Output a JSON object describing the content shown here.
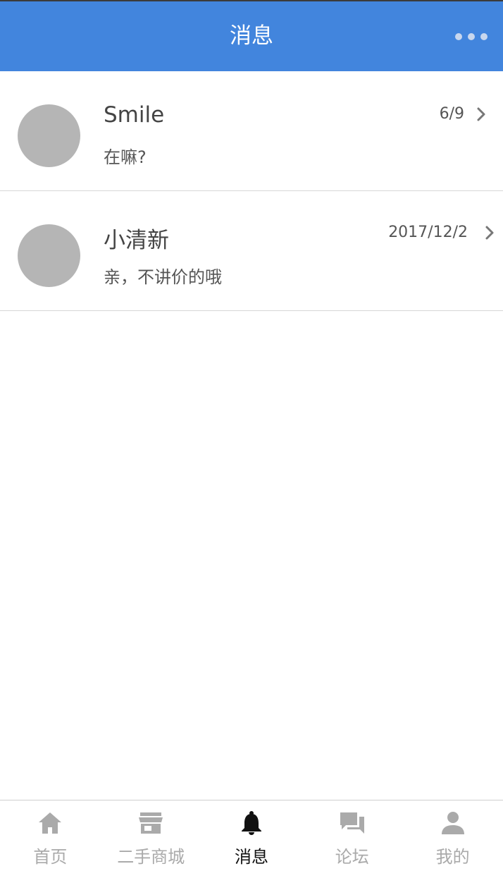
{
  "header": {
    "title": "消息"
  },
  "messages": [
    {
      "name": "Smile",
      "preview": "在嘛?",
      "date": "6/9"
    },
    {
      "name": "小清新",
      "preview": "亲，不讲价的哦",
      "date": "2017/12/2"
    }
  ],
  "tabs": [
    {
      "label": "首页",
      "icon": "home-icon"
    },
    {
      "label": "二手商城",
      "icon": "store-icon"
    },
    {
      "label": "消息",
      "icon": "bell-icon",
      "active": true
    },
    {
      "label": "论坛",
      "icon": "forum-icon"
    },
    {
      "label": "我的",
      "icon": "person-icon"
    }
  ],
  "colors": {
    "header_bg": "#4285dd",
    "avatar": "#b5b5b5",
    "tab_inactive": "#aaaaaa",
    "tab_active": "#111111"
  }
}
